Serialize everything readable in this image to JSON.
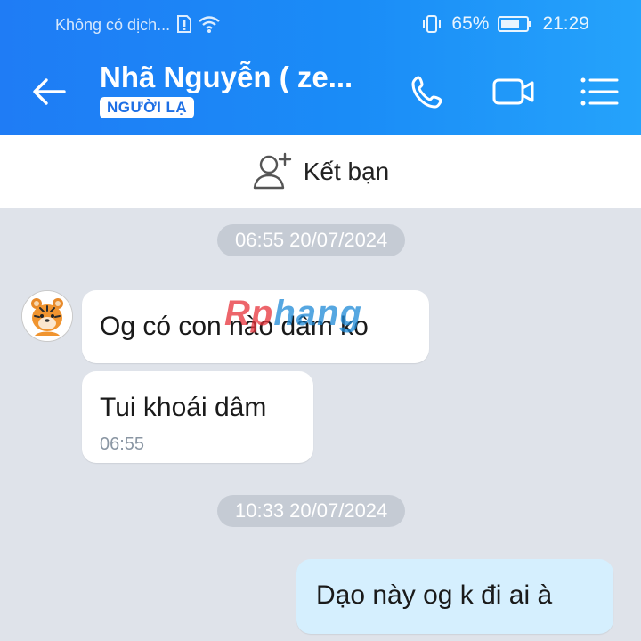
{
  "status_bar": {
    "carrier": "Không có dịch...",
    "battery": "65%",
    "time": "21:29"
  },
  "header": {
    "title": "Nhã Nguyễn ( ze...",
    "badge": "NGƯỜI LẠ"
  },
  "add_friend": {
    "label": "Kết bạn"
  },
  "watermark": {
    "part_a": "Rp",
    "part_b": "hang"
  },
  "messages": [
    {
      "timestamp": "06:55 20/07/2024"
    },
    {
      "text": "Og có con nào dâm ko"
    },
    {
      "text": "Tui khoái dâm",
      "time": "06:55"
    },
    {
      "timestamp": "10:33 20/07/2024"
    },
    {
      "text": "Dạo này og k đi ai à"
    }
  ],
  "colors": {
    "header_blue": "#1f7cf5",
    "sent_bubble": "#d5effe",
    "chat_bg": "#dfe3ea"
  }
}
